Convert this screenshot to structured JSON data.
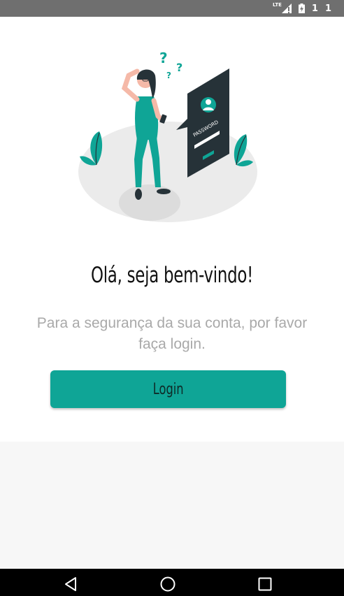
{
  "status_bar": {
    "network_type": "LTE",
    "indicator_a": "1",
    "indicator_b": "1",
    "icons": [
      "signal-icon",
      "battery-charging-icon"
    ]
  },
  "welcome": {
    "title": "Olá, seja bem-vindo!",
    "subtitle": "Para a segurança da sua conta, por favor faça login.",
    "illustration_label": "PASSWORD"
  },
  "login_button": {
    "label": "Login"
  },
  "nav_bar": {
    "icons": [
      "back-icon",
      "home-icon",
      "recent-apps-icon"
    ]
  },
  "colors": {
    "accent": "#0fa596",
    "accent_dark": "#263238",
    "subtitle_text": "#a9a9a9",
    "status_bar": "#6f6f6f",
    "background": "#f7f7f7"
  }
}
